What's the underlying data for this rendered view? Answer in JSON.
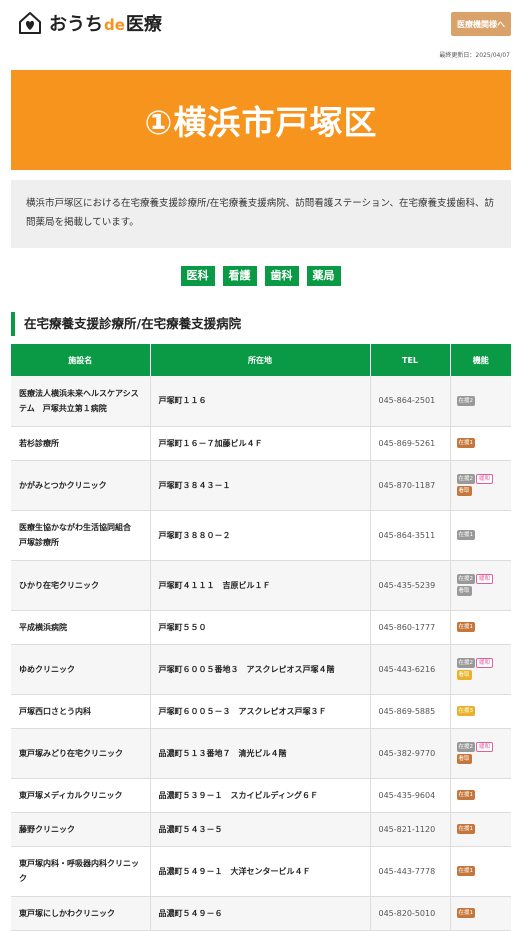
{
  "header": {
    "logo_text_main": "おうち",
    "logo_text_de": "de",
    "logo_text_tail": "医療",
    "logo_icon": "house-heart-icon",
    "button_label": "医療機関様へ",
    "updated": "最終更新日：2025/04/07"
  },
  "hero": {
    "title": "①横浜市戸塚区"
  },
  "intro": {
    "text": "横浜市戸塚区における在宅療養支援診療所/在宅療養支援病院、訪問看護ステーション、在宅療養支援歯科、訪問薬局を掲載しています。"
  },
  "filters": [
    "医科",
    "看護",
    "歯科",
    "薬局"
  ],
  "section": {
    "title": "在宅療養支援診療所/在宅療養支援病院"
  },
  "table": {
    "headers": [
      "施設名",
      "所在地",
      "TEL",
      "機能"
    ],
    "rows": [
      {
        "name": "医療法人横浜未来ヘルスケアシステム　戸塚共立第１病院",
        "address": "戸塚町１１６",
        "tel": "045-864-2501",
        "badges": [
          {
            "label": "在援2",
            "color": "gray"
          }
        ]
      },
      {
        "name": "若杉診療所",
        "address": "戸塚町１６－７加藤ビル４Ｆ",
        "tel": "045-869-5261",
        "badges": [
          {
            "label": "在援1",
            "color": "brown"
          }
        ]
      },
      {
        "name": "かがみとつかクリニック",
        "address": "戸塚町３８４３－１",
        "tel": "045-870-1187",
        "badges": [
          {
            "label": "在援2",
            "color": "gray"
          },
          {
            "label": "緩和",
            "color": "pink"
          },
          {
            "label": "看取",
            "color": "brown"
          }
        ]
      },
      {
        "name": "医療生協かながわ生活協同組合　戸塚診療所",
        "address": "戸塚町３８８０－２",
        "tel": "045-864-3511",
        "badges": [
          {
            "label": "在援1",
            "color": "gray"
          }
        ]
      },
      {
        "name": "ひかり在宅クリニック",
        "address": "戸塚町４１１１　吉原ビル１Ｆ",
        "tel": "045-435-5239",
        "badges": [
          {
            "label": "在援2",
            "color": "gray"
          },
          {
            "label": "緩和",
            "color": "pink"
          },
          {
            "label": "看取",
            "color": "gray"
          }
        ]
      },
      {
        "name": "平成横浜病院",
        "address": "戸塚町５５０",
        "tel": "045-860-1777",
        "badges": [
          {
            "label": "在援1",
            "color": "brown"
          }
        ]
      },
      {
        "name": "ゆめクリニック",
        "address": "戸塚町６００５番地３　アスクレピオス戸塚４階",
        "tel": "045-443-6216",
        "badges": [
          {
            "label": "在援2",
            "color": "gray"
          },
          {
            "label": "緩和",
            "color": "pink"
          },
          {
            "label": "看取",
            "color": "yellow"
          }
        ]
      },
      {
        "name": "戸塚西口さとう内科",
        "address": "戸塚町６００５－３　アスクレピオス戸塚３Ｆ",
        "tel": "045-869-5885",
        "badges": [
          {
            "label": "在援3",
            "color": "yellow"
          }
        ]
      },
      {
        "name": "東戸塚みどり在宅クリニック",
        "address": "品濃町５１３番地７　清光ビル４階",
        "tel": "045-382-9770",
        "badges": [
          {
            "label": "在援2",
            "color": "gray"
          },
          {
            "label": "緩和",
            "color": "pink"
          },
          {
            "label": "看取",
            "color": "brown"
          }
        ]
      },
      {
        "name": "東戸塚メディカルクリニック",
        "address": "品濃町５３９－１　スカイビルディング６Ｆ",
        "tel": "045-435-9604",
        "badges": [
          {
            "label": "在援1",
            "color": "brown"
          }
        ]
      },
      {
        "name": "藤野クリニック",
        "address": "品濃町５４３－５",
        "tel": "045-821-1120",
        "badges": [
          {
            "label": "在援1",
            "color": "brown"
          }
        ]
      },
      {
        "name": "東戸塚内科・呼吸器内科クリニック",
        "address": "品濃町５４９－１　大洋センタービル４Ｆ",
        "tel": "045-443-7778",
        "badges": [
          {
            "label": "在援1",
            "color": "brown"
          }
        ]
      },
      {
        "name": "東戸塚にしかわクリニック",
        "address": "品濃町５４９－６",
        "tel": "045-820-5010",
        "badges": [
          {
            "label": "在援1",
            "color": "brown"
          }
        ]
      }
    ]
  }
}
